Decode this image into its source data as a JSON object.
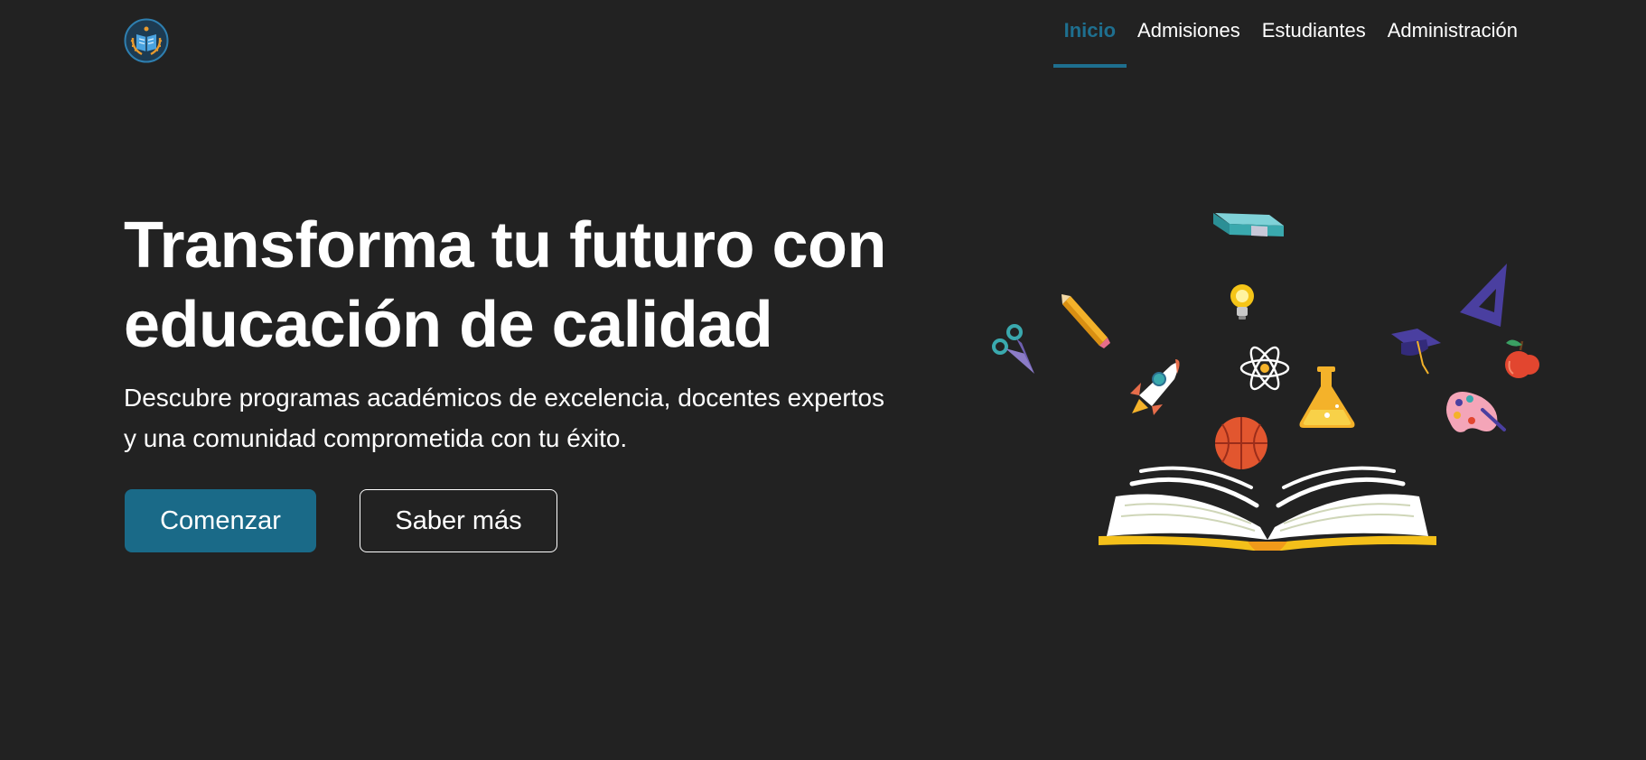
{
  "nav": {
    "items": [
      {
        "label": "Inicio",
        "active": true
      },
      {
        "label": "Admisiones",
        "active": false
      },
      {
        "label": "Estudiantes",
        "active": false
      },
      {
        "label": "Administración",
        "active": false
      }
    ]
  },
  "hero": {
    "title": "Transforma tu futuro con educación de calidad",
    "description": "Descubre programas académicos de excelencia, docentes expertos y una comunidad comprometida con tu éxito.",
    "primary_button": "Comenzar",
    "secondary_button": "Saber más"
  },
  "colors": {
    "background": "#222222",
    "accent": "#1e6f8f",
    "primary_button": "#1a6a88",
    "text": "#ffffff"
  },
  "icons": {
    "logo": "graduation-book-logo",
    "illustration": "open-book-with-school-supplies"
  }
}
